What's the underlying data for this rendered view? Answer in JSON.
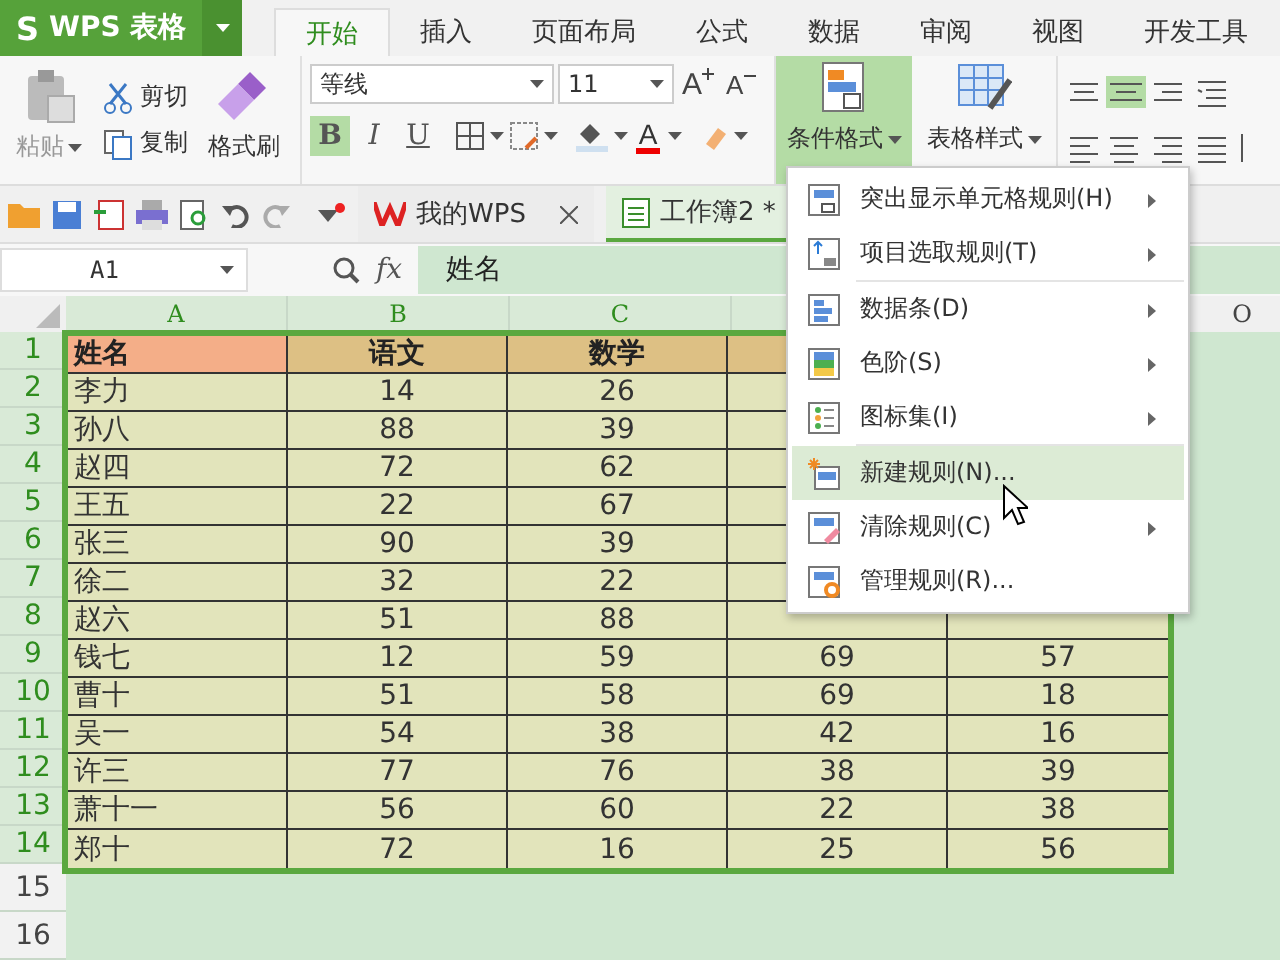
{
  "app": {
    "logo": "S",
    "name": "WPS 表格"
  },
  "tabs": [
    {
      "label": "开始",
      "selected": true
    },
    {
      "label": "插入",
      "selected": false
    },
    {
      "label": "页面布局",
      "selected": false
    },
    {
      "label": "公式",
      "selected": false
    },
    {
      "label": "数据",
      "selected": false
    },
    {
      "label": "审阅",
      "selected": false
    },
    {
      "label": "视图",
      "selected": false
    },
    {
      "label": "开发工具",
      "selected": false
    }
  ],
  "ribbon": {
    "paste": {
      "label": "粘贴",
      "disabled": true
    },
    "cut": "剪切",
    "copy": "复制",
    "format_painter": "格式刷",
    "font_family": "等线",
    "font_size": "11",
    "grow_font": "A",
    "shrink_font": "A",
    "format_buttons": [
      {
        "label": "B",
        "selected": true
      },
      {
        "label": "I",
        "selected": false
      },
      {
        "label": "U",
        "selected": false
      }
    ],
    "font_color": "A",
    "conditional_format": {
      "label": "条件格式",
      "expanded": true
    },
    "table_style": "表格样式"
  },
  "doc_tabs": [
    {
      "label": "我的WPS",
      "selected": false
    },
    {
      "label": "工作簿2 *",
      "selected": true
    }
  ],
  "formula_bar": {
    "name_box": "A1",
    "fx": "fx",
    "value": "姓名"
  },
  "sheet": {
    "columns": [
      "A",
      "B",
      "C"
    ],
    "column_6": "O",
    "rows": [
      {
        "number": "1",
        "kind": "header",
        "cells": [
          "姓名",
          "语文",
          "数学"
        ]
      },
      {
        "number": "2",
        "kind": "data",
        "cells": [
          "李力",
          "14",
          "26"
        ]
      },
      {
        "number": "3",
        "kind": "data",
        "cells": [
          "孙八",
          "88",
          "39"
        ]
      },
      {
        "number": "4",
        "kind": "data",
        "cells": [
          "赵四",
          "72",
          "62"
        ]
      },
      {
        "number": "5",
        "kind": "data",
        "cells": [
          "王五",
          "22",
          "67"
        ]
      },
      {
        "number": "6",
        "kind": "data",
        "cells": [
          "张三",
          "90",
          "39"
        ]
      },
      {
        "number": "7",
        "kind": "data",
        "cells": [
          "徐二",
          "32",
          "22"
        ]
      },
      {
        "number": "8",
        "kind": "data",
        "cells": [
          "赵六",
          "51",
          "88"
        ]
      },
      {
        "number": "9",
        "kind": "data",
        "cells": [
          "钱七",
          "12",
          "59",
          "69",
          "57"
        ]
      },
      {
        "number": "10",
        "kind": "data",
        "cells": [
          "曹十",
          "51",
          "58",
          "69",
          "18"
        ]
      },
      {
        "number": "11",
        "kind": "data",
        "cells": [
          "吴一",
          "54",
          "38",
          "42",
          "16"
        ]
      },
      {
        "number": "12",
        "kind": "data",
        "cells": [
          "许三",
          "77",
          "76",
          "38",
          "39"
        ]
      },
      {
        "number": "13",
        "kind": "data",
        "cells": [
          "萧十一",
          "56",
          "60",
          "22",
          "38"
        ]
      },
      {
        "number": "14",
        "kind": "data",
        "cells": [
          "郑十",
          "72",
          "16",
          "25",
          "56"
        ]
      }
    ],
    "empty_rows": [
      "15",
      "16"
    ]
  },
  "menu": {
    "groups": [
      [
        {
          "label": "突出显示单元格规则(H)",
          "submenu": true,
          "selected": false
        },
        {
          "label": "项目选取规则(T)",
          "submenu": true,
          "selected": false
        }
      ],
      [
        {
          "label": "数据条(D)",
          "submenu": true,
          "selected": false
        },
        {
          "label": "色阶(S)",
          "submenu": true,
          "selected": false
        },
        {
          "label": "图标集(I)",
          "submenu": true,
          "selected": false
        }
      ],
      [
        {
          "label": "新建规则(N)...",
          "submenu": false,
          "selected": true
        },
        {
          "label": "清除规则(C)",
          "submenu": true,
          "selected": false
        },
        {
          "label": "管理规则(R)...",
          "submenu": false,
          "selected": false
        }
      ]
    ]
  }
}
